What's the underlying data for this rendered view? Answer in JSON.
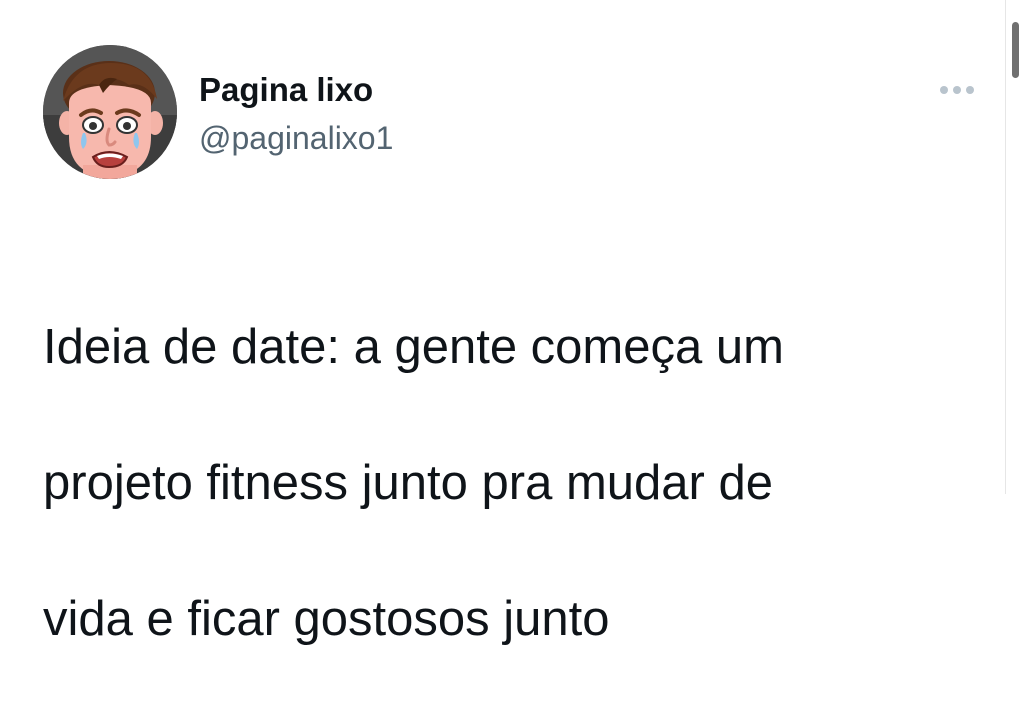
{
  "tweet": {
    "author": {
      "display_name": "Pagina lixo",
      "handle": "@paginalixo1",
      "avatar_icon": "cartoon-crying-man-avatar"
    },
    "more_icon": "more-horizontal-icon",
    "lines": [
      "Ideia de date: a gente começa um",
      "projeto fitness junto pra mudar de",
      "vida e ficar gostosos junto"
    ]
  },
  "colors": {
    "text_primary": "#0f1419",
    "text_secondary": "#536471",
    "more_dots": "#b9c4cd",
    "background": "#ffffff",
    "scrollbar_thumb": "#707070"
  }
}
